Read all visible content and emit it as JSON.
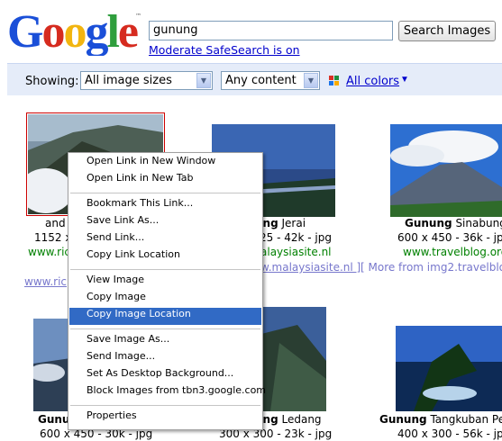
{
  "header": {
    "logo_text": "Google",
    "search_value": "gunung",
    "search_button": "Search Images",
    "safesearch": "Moderate SafeSearch is on"
  },
  "filters": {
    "showing_label": "Showing:",
    "size_select": "All image sizes",
    "content_select": "Any content",
    "colors_link": "All colors",
    "colors_arrow": "▼"
  },
  "results": [
    {
      "title_bold": "",
      "title": "and",
      "dims": "1152 x",
      "site": "www.ric",
      "more": "www.ric"
    },
    {
      "title_bold": "ung",
      "title": " Jerai",
      "dims": "25 - 42k - jpg",
      "site": "alaysiasite.nl",
      "more": "w.malaysiasite.nl ]"
    },
    {
      "title_bold": "Gunung",
      "title": " Sinabung",
      "dims": "600 x 450 - 36k - jpg",
      "site": "www.travelblog.org",
      "more": "[ More from img2.travelblo"
    },
    {
      "title_bold": "Gunu",
      "title": "",
      "dims": "600 x 450 - 30k - jpg",
      "site": "",
      "more": ""
    },
    {
      "title_bold": "ung",
      "title": " Ledang",
      "dims": "300 x 300 - 23k - jpg",
      "site": "",
      "more": ""
    },
    {
      "title_bold": "Gunung",
      "title": " Tangkuban Pe",
      "dims": "400 x 300 - 56k - jp",
      "site": "",
      "more": ""
    }
  ],
  "context_menu": {
    "groups": [
      [
        "Open Link in New Window",
        "Open Link in New Tab"
      ],
      [
        "Bookmark This Link...",
        "Save Link As...",
        "Send Link...",
        "Copy Link Location"
      ],
      [
        "View Image",
        "Copy Image",
        "Copy Image Location"
      ],
      [
        "Save Image As...",
        "Send Image...",
        "Set As Desktop Background...",
        "Block Images from tbn3.google.com"
      ],
      [
        "Properties"
      ]
    ],
    "highlighted": "Copy Image Location"
  },
  "colors": {
    "link": "#0000cc",
    "site_green": "#008000",
    "filter_bar": "#e5ecf9",
    "menu_highlight": "#316ac5"
  }
}
